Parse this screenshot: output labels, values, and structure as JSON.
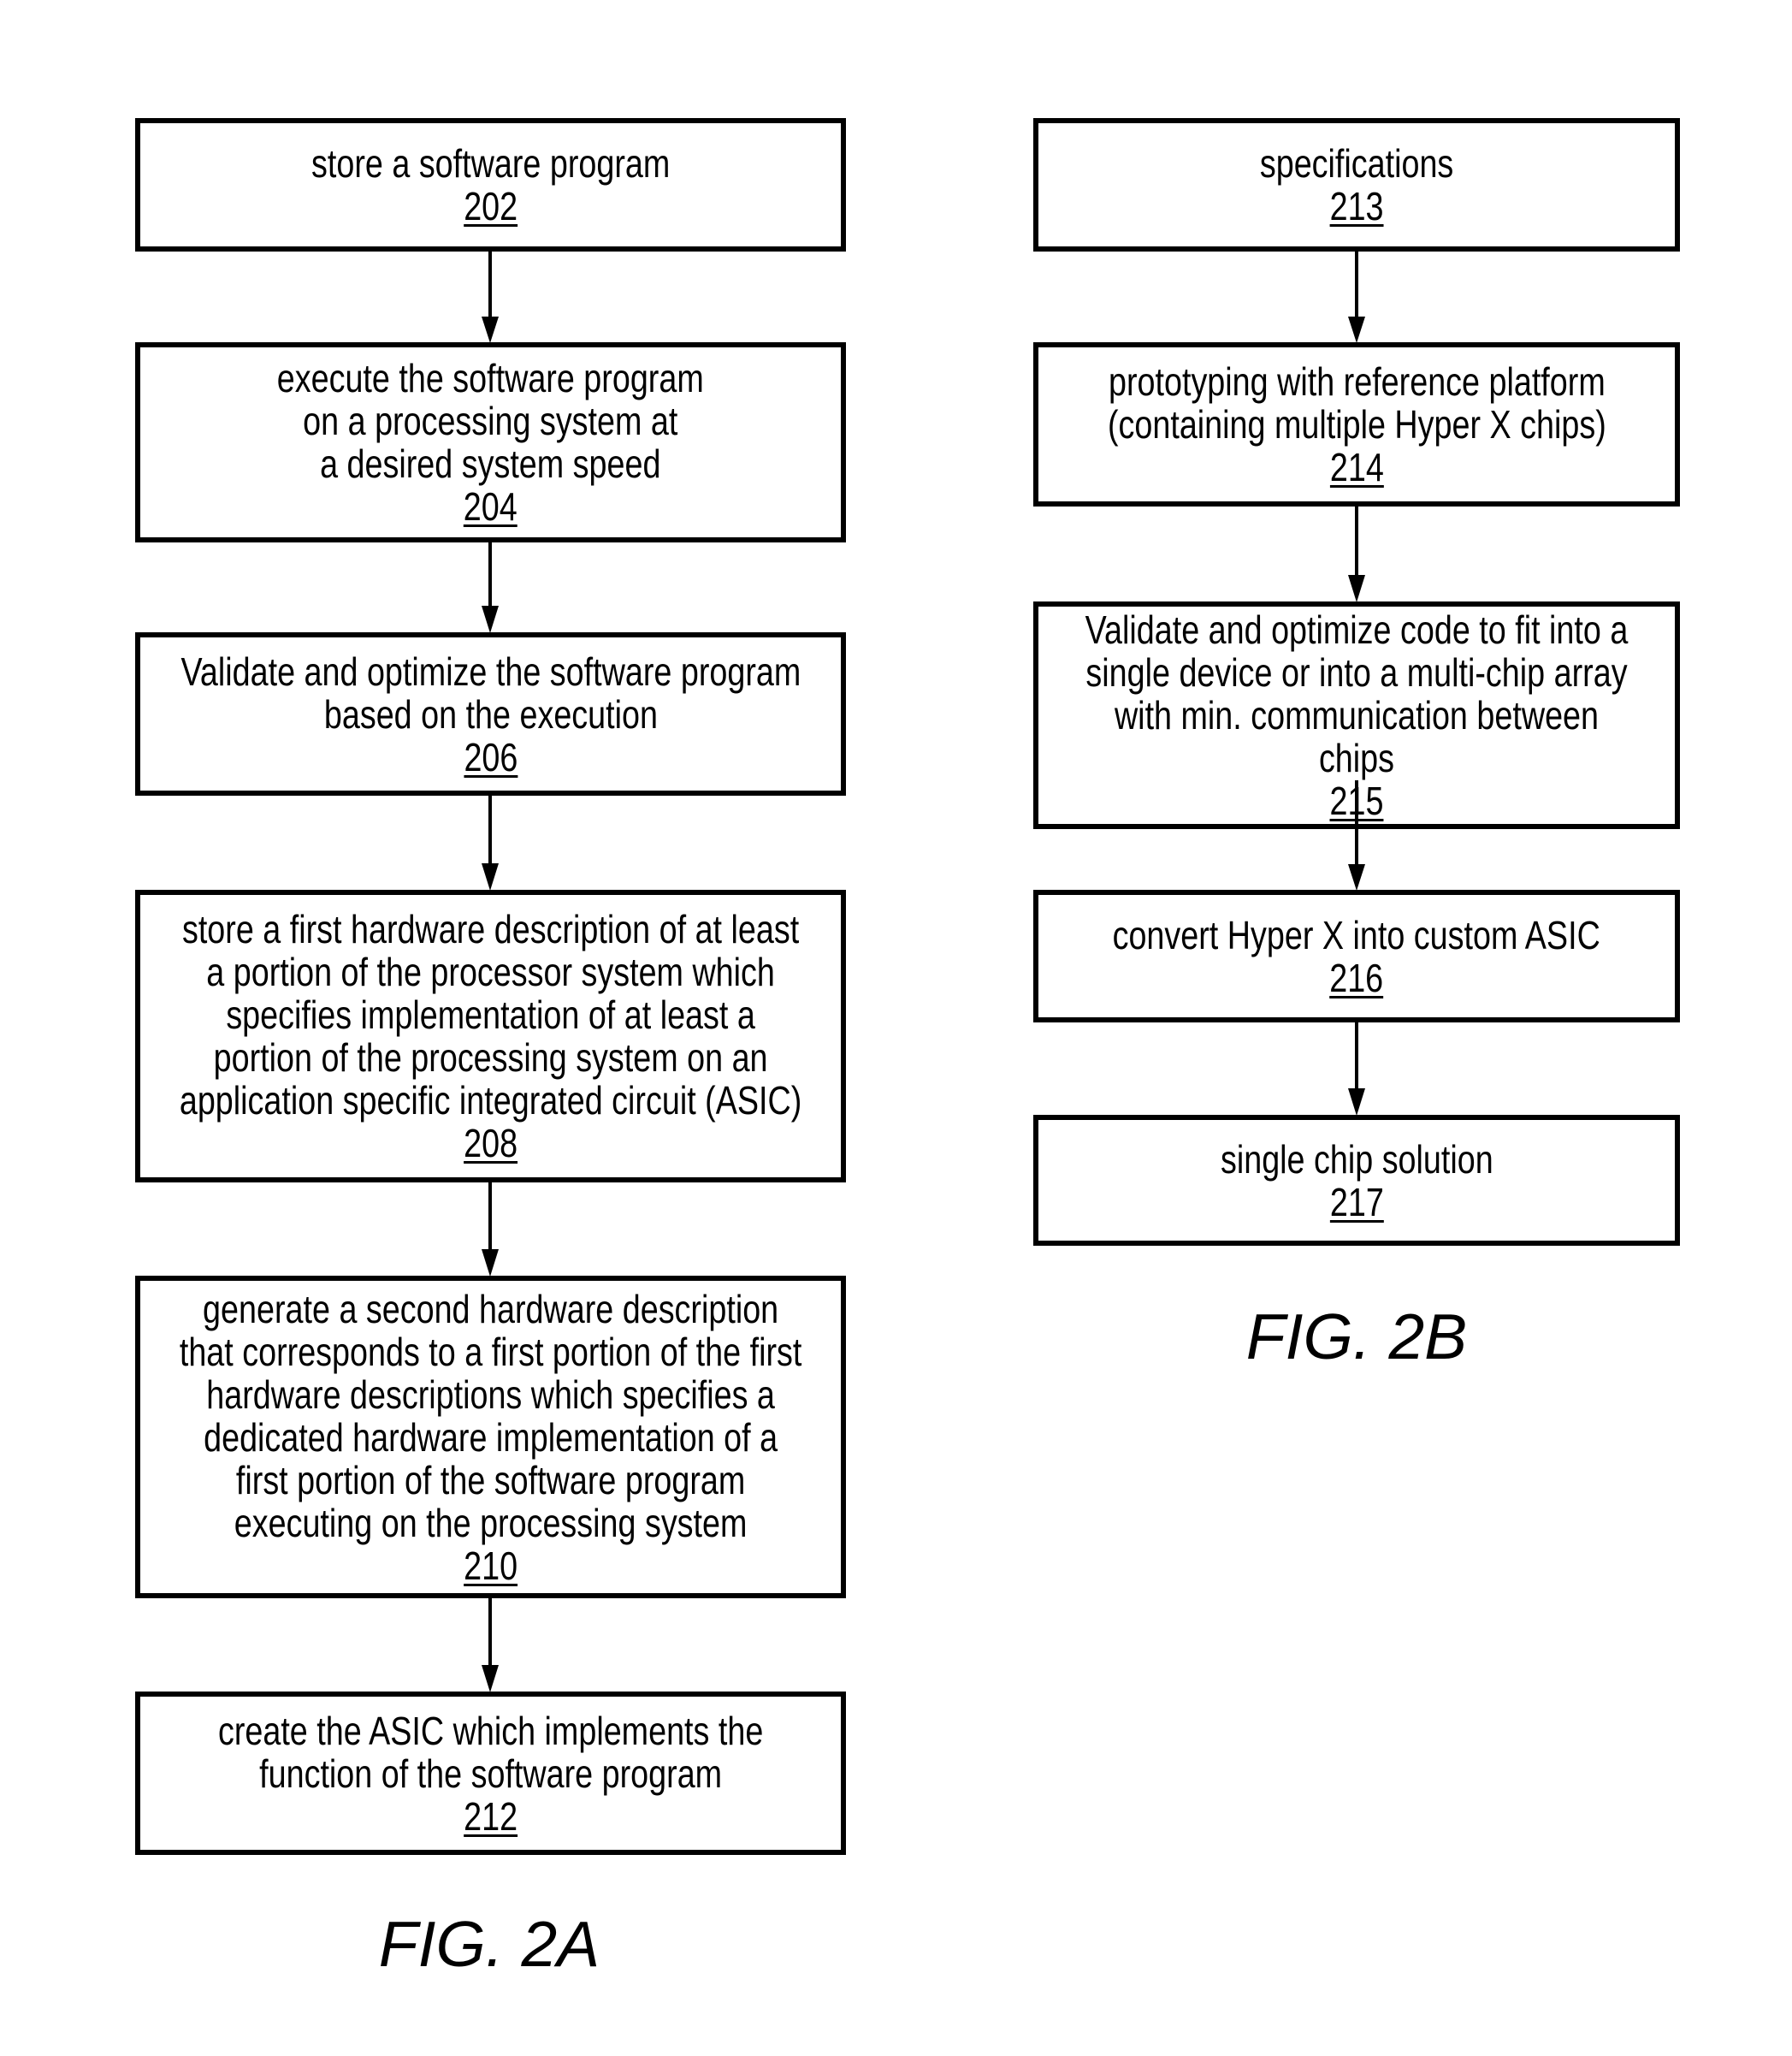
{
  "figures": [
    {
      "label": "FIG. 2A",
      "steps": [
        {
          "lines": [
            "store a software program"
          ],
          "ref": "202"
        },
        {
          "lines": [
            "execute the software program",
            "on a processing system at",
            "a desired system speed"
          ],
          "ref": "204"
        },
        {
          "lines": [
            "Validate and optimize the software program",
            "based on the execution"
          ],
          "ref": "206"
        },
        {
          "lines": [
            "store a first hardware description of at least",
            "a portion of the processor system which",
            "specifies implementation of at least a",
            "portion of the processing system on an",
            "application specific integrated circuit (ASIC)"
          ],
          "ref": "208"
        },
        {
          "lines": [
            "generate a second hardware description",
            "that corresponds to a first portion of the first",
            "hardware descriptions which specifies a",
            "dedicated hardware implementation of a",
            "first portion of the software program",
            "executing on the processing system"
          ],
          "ref": "210"
        },
        {
          "lines": [
            "create the ASIC which implements the",
            "function of the software program"
          ],
          "ref": "212"
        }
      ]
    },
    {
      "label": "FIG. 2B",
      "steps": [
        {
          "lines": [
            "specifications"
          ],
          "ref": "213"
        },
        {
          "lines": [
            "prototyping with reference platform",
            "(containing multiple Hyper X chips)"
          ],
          "ref": "214"
        },
        {
          "lines": [
            "Validate and optimize code to fit into a",
            "single device or into a multi-chip array",
            "with min. communication between",
            "chips"
          ],
          "ref": "215"
        },
        {
          "lines": [
            "convert Hyper X into custom ASIC"
          ],
          "ref": "216"
        },
        {
          "lines": [
            "single chip solution"
          ],
          "ref": "217"
        }
      ]
    }
  ]
}
